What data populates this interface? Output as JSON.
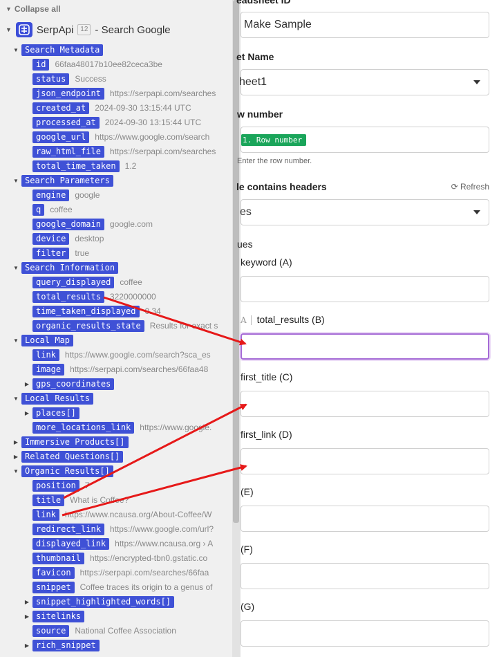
{
  "left": {
    "collapse_all": "Collapse all",
    "app": {
      "name": "SerpApi",
      "badge": "12",
      "suffix": "- Search Google"
    },
    "tree": [
      {
        "d": 1,
        "caret": "open",
        "label": "Search Metadata"
      },
      {
        "d": 2,
        "label": "id",
        "value": "66faa48017b10ee82ceca3be"
      },
      {
        "d": 2,
        "label": "status",
        "value": "Success"
      },
      {
        "d": 2,
        "label": "json_endpoint",
        "value": "https://serpapi.com/searches"
      },
      {
        "d": 2,
        "label": "created_at",
        "value": "2024-09-30 13:15:44 UTC"
      },
      {
        "d": 2,
        "label": "processed_at",
        "value": "2024-09-30 13:15:44 UTC"
      },
      {
        "d": 2,
        "label": "google_url",
        "value": "https://www.google.com/search"
      },
      {
        "d": 2,
        "label": "raw_html_file",
        "value": "https://serpapi.com/searches"
      },
      {
        "d": 2,
        "label": "total_time_taken",
        "value": "1.2"
      },
      {
        "d": 1,
        "caret": "open",
        "label": "Search Parameters"
      },
      {
        "d": 2,
        "label": "engine",
        "value": "google"
      },
      {
        "d": 2,
        "label": "q",
        "value": "coffee"
      },
      {
        "d": 2,
        "label": "google_domain",
        "value": "google.com"
      },
      {
        "d": 2,
        "label": "device",
        "value": "desktop"
      },
      {
        "d": 2,
        "label": "filter",
        "value": "true"
      },
      {
        "d": 1,
        "caret": "open",
        "label": "Search Information"
      },
      {
        "d": 2,
        "label": "query_displayed",
        "value": "coffee"
      },
      {
        "d": 2,
        "label": "total_results",
        "value": "3220000000"
      },
      {
        "d": 2,
        "label": "time_taken_displayed",
        "value": "0.34"
      },
      {
        "d": 2,
        "label": "organic_results_state",
        "value": "Results for exact s"
      },
      {
        "d": 1,
        "caret": "open",
        "label": "Local Map"
      },
      {
        "d": 2,
        "label": "link",
        "value": "https://www.google.com/search?sca_es"
      },
      {
        "d": 2,
        "label": "image",
        "value": "https://serpapi.com/searches/66faa48"
      },
      {
        "d": 2,
        "caret": "closed",
        "label": "gps_coordinates"
      },
      {
        "d": 1,
        "caret": "open",
        "label": "Local Results"
      },
      {
        "d": 2,
        "caret": "closed",
        "label": "places[]"
      },
      {
        "d": 2,
        "label": "more_locations_link",
        "value": "https://www.google."
      },
      {
        "d": 1,
        "caret": "closed",
        "label": "Immersive Products[]"
      },
      {
        "d": 1,
        "caret": "closed",
        "label": "Related Questions[]"
      },
      {
        "d": 1,
        "caret": "open",
        "label": "Organic Results[]"
      },
      {
        "d": 2,
        "label": "position",
        "value": "7"
      },
      {
        "d": 2,
        "label": "title",
        "value": "What is Coffee?"
      },
      {
        "d": 2,
        "label": "link",
        "value": "https://www.ncausa.org/About-Coffee/W"
      },
      {
        "d": 2,
        "label": "redirect_link",
        "value": "https://www.google.com/url?"
      },
      {
        "d": 2,
        "label": "displayed_link",
        "value": "https://www.ncausa.org › A"
      },
      {
        "d": 2,
        "label": "thumbnail",
        "value": "https://encrypted-tbn0.gstatic.co"
      },
      {
        "d": 2,
        "label": "favicon",
        "value": "https://serpapi.com/searches/66faa"
      },
      {
        "d": 2,
        "label": "snippet",
        "value": "Coffee traces its origin to a genus of"
      },
      {
        "d": 2,
        "caret": "closed",
        "label": "snippet_highlighted_words[]"
      },
      {
        "d": 2,
        "caret": "closed",
        "label": "sitelinks"
      },
      {
        "d": 2,
        "label": "source",
        "value": "National Coffee Association"
      },
      {
        "d": 2,
        "caret": "closed",
        "label": "rich_snippet"
      }
    ]
  },
  "right": {
    "spreadsheet_id_label": "eadsheet ID",
    "spreadsheet_id_value": "Make Sample",
    "sheet_name_label": "et Name",
    "sheet_name_value": "heet1",
    "row_number_label": "w number",
    "row_number_pill": "1. Row number",
    "row_number_hint": "Enter the row number.",
    "headers_label": "le contains headers",
    "refresh_label": "Refresh",
    "headers_value": "es",
    "values_label": "ues",
    "fields": [
      {
        "label": "keyword (A)",
        "focused": false
      },
      {
        "label": "total_results (B)",
        "focused": true,
        "prefix": "A"
      },
      {
        "label": "first_title (C)",
        "focused": false
      },
      {
        "label": "first_link (D)",
        "focused": false
      },
      {
        "label": "(E)",
        "focused": false
      },
      {
        "label": "(F)",
        "focused": false
      },
      {
        "label": "(G)",
        "focused": false
      }
    ]
  },
  "colors": {
    "tag": "#3f51d6",
    "pill": "#1aa55a",
    "arrow": "#e61919",
    "focus": "#a56bd6"
  }
}
